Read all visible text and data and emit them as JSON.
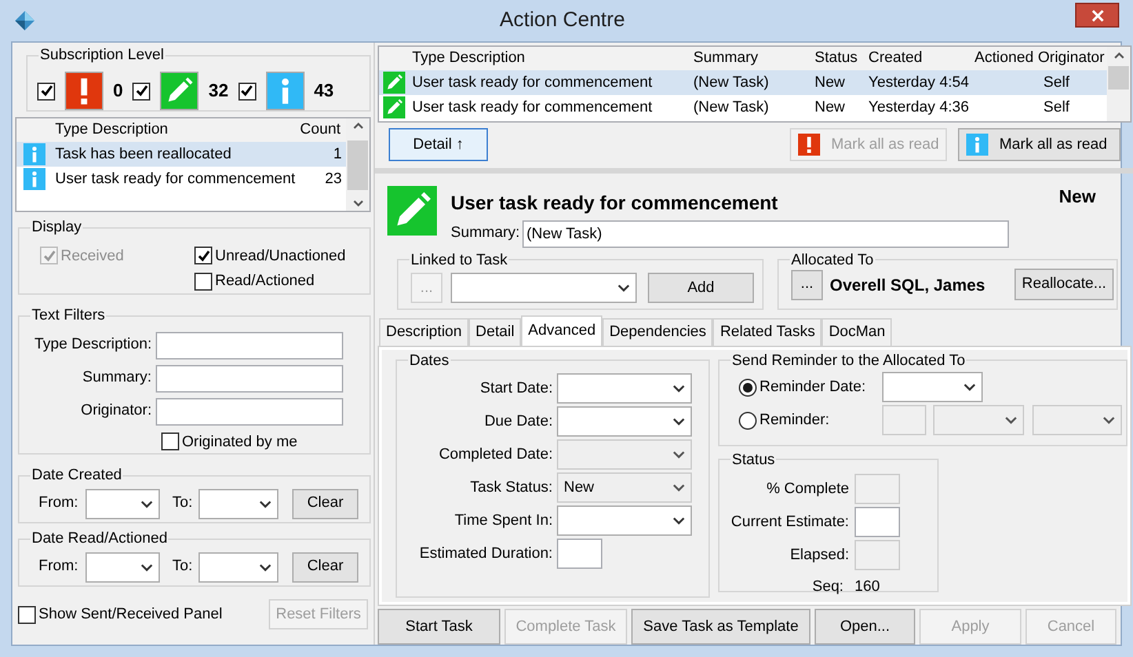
{
  "window": {
    "title": "Action Centre"
  },
  "subscription_level": {
    "title": "Subscription Level",
    "items": [
      {
        "kind": "alert",
        "checked": true,
        "count": "0"
      },
      {
        "kind": "task",
        "checked": true,
        "count": "32"
      },
      {
        "kind": "info",
        "checked": true,
        "count": "43"
      }
    ]
  },
  "type_list": {
    "columns": [
      "Type Description",
      "Count"
    ],
    "rows": [
      {
        "kind": "info",
        "description": "Task has been reallocated",
        "count": "1",
        "selected": true
      },
      {
        "kind": "info",
        "description": "User task ready for commencement",
        "count": "23",
        "selected": false
      }
    ]
  },
  "display": {
    "title": "Display",
    "options": [
      {
        "label": "Received",
        "checked": true,
        "disabled": true
      },
      {
        "label": "Unread/Unactioned",
        "checked": true,
        "disabled": false
      },
      {
        "label": "Read/Actioned",
        "checked": false,
        "disabled": false
      }
    ]
  },
  "text_filters": {
    "title": "Text Filters",
    "fields": [
      {
        "label": "Type Description:"
      },
      {
        "label": "Summary:"
      },
      {
        "label": "Originator:"
      }
    ],
    "originated_by_me": {
      "label": "Originated by me",
      "checked": false
    }
  },
  "date_filters": [
    {
      "title": "Date Created",
      "from_label": "From:",
      "to_label": "To:",
      "clear": "Clear"
    },
    {
      "title": "Date Read/Actioned",
      "from_label": "From:",
      "to_label": "To:",
      "clear": "Clear"
    }
  ],
  "show_panel": {
    "label": "Show Sent/Received Panel",
    "checked": false
  },
  "reset_filters": {
    "label": "Reset Filters",
    "disabled": true
  },
  "messages": {
    "columns": [
      "Type Description",
      "Summary",
      "Status",
      "Created",
      "Actioned",
      "Originator"
    ],
    "rows": [
      {
        "kind": "task",
        "description": "User task ready for commencement",
        "summary": "(New Task)",
        "status": "New",
        "created": "Yesterday 4:54",
        "originator": "Self",
        "selected": true
      },
      {
        "kind": "task",
        "description": "User task ready for commencement",
        "summary": "(New Task)",
        "status": "New",
        "created": "Yesterday 4:36",
        "originator": "Self",
        "selected": false
      }
    ]
  },
  "detail_button": "Detail ↑",
  "mark_buttons": [
    {
      "kind": "alert",
      "label": "Mark all as read",
      "disabled": true
    },
    {
      "kind": "info",
      "label": "Mark all as read",
      "disabled": false
    }
  ],
  "task": {
    "kind": "task",
    "title": "User task ready for commencement",
    "status": "New",
    "summary_label": "Summary:",
    "summary": "(New Task)"
  },
  "linked_to_task": {
    "title": "Linked to Task",
    "browse": {
      "label": "...",
      "disabled": true
    },
    "add": "Add"
  },
  "allocated_to": {
    "title": "Allocated To",
    "browse": "...",
    "name": "Overell SQL, James",
    "reallocate": "Reallocate..."
  },
  "tabs": [
    {
      "label": "Description",
      "selected": false
    },
    {
      "label": "Detail",
      "selected": false
    },
    {
      "label": "Advanced",
      "selected": true
    },
    {
      "label": "Dependencies",
      "selected": false
    },
    {
      "label": "Related Tasks",
      "selected": false
    },
    {
      "label": "DocMan",
      "selected": false
    }
  ],
  "dates": {
    "title": "Dates",
    "fields": [
      {
        "label": "Start Date:",
        "disabled": false
      },
      {
        "label": "Due Date:",
        "disabled": false
      },
      {
        "label": "Completed Date:",
        "disabled": true
      },
      {
        "label": "Task Status:",
        "value": "New",
        "disabled": true
      },
      {
        "label": "Time Spent In:",
        "disabled": false
      }
    ],
    "estimated_duration": {
      "label": "Estimated Duration:"
    }
  },
  "reminder": {
    "title": "Send Reminder to the Allocated To",
    "options": [
      {
        "label": "Reminder Date:",
        "selected": true
      },
      {
        "label": "Reminder:",
        "selected": false
      }
    ]
  },
  "status": {
    "title": "Status",
    "fields": [
      {
        "label": "% Complete",
        "disabled": true
      },
      {
        "label": "Current Estimate:",
        "disabled": false
      },
      {
        "label": "Elapsed:",
        "disabled": true
      }
    ],
    "seq_label": "Seq:",
    "seq": "160"
  },
  "actions": [
    {
      "label": "Start Task",
      "disabled": false
    },
    {
      "label": "Complete Task",
      "disabled": true
    },
    {
      "label": "Save Task as Template",
      "disabled": false
    },
    {
      "label": "Open...",
      "disabled": false
    },
    {
      "label": "Apply",
      "disabled": true
    },
    {
      "label": "Cancel",
      "disabled": true
    }
  ]
}
